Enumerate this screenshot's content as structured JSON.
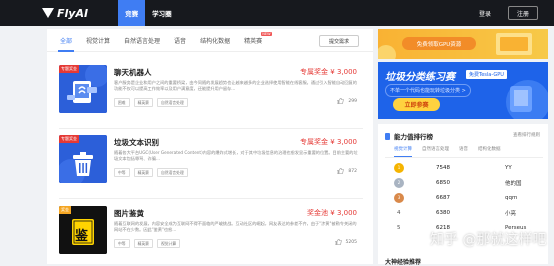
{
  "nav": {
    "brand": "FlyAI",
    "tabs": [
      {
        "label": "竞赛",
        "active": true
      },
      {
        "label": "学习圈",
        "active": false
      }
    ],
    "login": "登录",
    "register": "注册"
  },
  "filters": {
    "items": [
      {
        "label": "全部",
        "active": true
      },
      {
        "label": "视觉计算"
      },
      {
        "label": "自然语言处理"
      },
      {
        "label": "语音"
      },
      {
        "label": "结构化数据"
      },
      {
        "label": "精英赛",
        "new": "NEW"
      }
    ],
    "submit": "提交需求"
  },
  "tasks": [
    {
      "badge": "专题奖金",
      "badge_color": "#e53935",
      "title": "聊天机器人",
      "prize": "专属奖金 ¥ 3,000",
      "desc": "客户服务是企业和用户之间的重要桥梁，由今同随的发展趋势也让越来越多的企业选择使用智能在线客服。通过引入智能自动回复的功能不仅可以提高工作效率以及用户满意度，还能提升用户留存...",
      "tags": [
        "困难",
        "精英赛",
        "自然语言处理"
      ],
      "likes": "299",
      "icon": "chatbot-icon"
    },
    {
      "badge": "专题奖金",
      "badge_color": "#e53935",
      "title": "垃圾文本识别",
      "prize": "专属奖金 ¥ 3,000",
      "desc": "随着各大平台UGC(User Generated Content)内容的爆炸式增长，对于其中垃圾信息的治理也愈发显示重要的位置。目前主要的垃圾文本包括辱骂、诈骗…",
      "tags": [
        "中等",
        "精英赛",
        "自然语言处理"
      ],
      "likes": "872",
      "icon": "trash-icon"
    },
    {
      "badge": "奖金",
      "badge_color": "#f5a623",
      "title": "图片鉴黄",
      "prize": "奖金池 ¥ 3,000",
      "desc": "随着互联网的发展，内容安全成为互联网不得不面临的严峻挑战。互动社区的崛起，网友表达的参差不齐，由于\"涉黄\"被勒令关闭的网站不在少数。因此\"鉴黄\"也愈…",
      "tags": [
        "中等",
        "精英赛",
        "视觉计算"
      ],
      "likes": "5205",
      "icon": "jian-icon",
      "icon_char": "鉴"
    }
  ],
  "side": {
    "gpu_banner": "免费领取GPU资源",
    "practice": {
      "title": "垃圾分类练习赛",
      "sub": "免费Tesla-GPU",
      "line": "不单一个代码也能玩转垃圾分类 >",
      "join": "立即参赛"
    },
    "ranking": {
      "title": "能力值排行榜",
      "rules": "查看排行规则",
      "tabs": [
        {
          "label": "视觉计算",
          "active": true
        },
        {
          "label": "自然语言处理"
        },
        {
          "label": "语音"
        },
        {
          "label": "结构化数据"
        }
      ],
      "rows": [
        {
          "pos": "1",
          "score": "7548",
          "user": "YY"
        },
        {
          "pos": "2",
          "score": "6850",
          "user": "他的国"
        },
        {
          "pos": "3",
          "score": "6687",
          "user": "qqm"
        },
        {
          "pos": "4",
          "score": "6380",
          "user": "小亮"
        },
        {
          "pos": "5",
          "score": "6218",
          "user": "Perseus"
        }
      ]
    },
    "footer_title": "大神经验推荐"
  },
  "watermark": "知乎 @那就这样吧",
  "colors": {
    "accent": "#3f7df3",
    "prize": "#e53935",
    "dark": "#17191e"
  }
}
